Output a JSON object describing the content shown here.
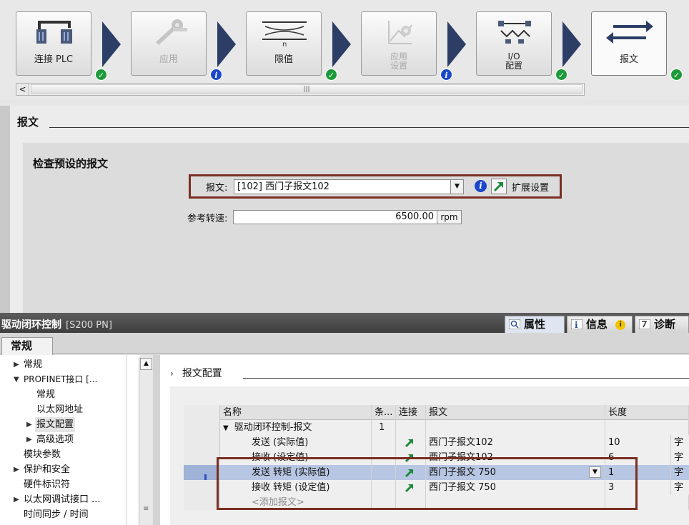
{
  "wizard": {
    "steps": [
      {
        "label": "连接 PLC",
        "icon": "plc-network-icon",
        "status": "ok"
      },
      {
        "label": "应用",
        "icon": "wrench-icon",
        "status": "info"
      },
      {
        "label": "限值",
        "icon": "limit-icon",
        "status": "ok"
      },
      {
        "label_line1": "应用",
        "label_line2": "设置",
        "icon": "app-settings-icon",
        "status": "info"
      },
      {
        "label_line1": "I/O",
        "label_line2": "配置",
        "icon": "io-config-icon",
        "status": "ok"
      },
      {
        "label": "报文",
        "icon": "telegram-arrows-icon",
        "status": "ok"
      }
    ],
    "scroll_left": "<",
    "scroll_grip": "|||"
  },
  "section": {
    "title": "报文",
    "panel_title": "检查预设的报文",
    "telegram_label": "报文:",
    "telegram_value": "[102] 西门子报文102",
    "extended_settings": "扩展设置",
    "ref_speed_label": "参考转速:",
    "ref_speed_value": "6500.00",
    "ref_speed_unit": "rpm"
  },
  "inspector": {
    "title": "驱动闭环控制",
    "subtitle": "[S200 PN]",
    "tabs": {
      "properties": "属性",
      "info": "信息",
      "diagnostics": "诊断"
    },
    "general_tab": "常规"
  },
  "tree": {
    "items": [
      {
        "label": "常规",
        "twisty": "▶"
      },
      {
        "label": "PROFINET接口 [...",
        "twisty": "▼"
      },
      {
        "label": "常规",
        "twisty": ""
      },
      {
        "label": "以太网地址",
        "twisty": ""
      },
      {
        "label": "报文配置",
        "twisty": "▶"
      },
      {
        "label": "高级选项",
        "twisty": "▶"
      },
      {
        "label": "模块参数",
        "twisty": ""
      },
      {
        "label": "保护和安全",
        "twisty": "▶"
      },
      {
        "label": "硬件标识符",
        "twisty": ""
      },
      {
        "label": "以太网调试接口 ...",
        "twisty": "▶"
      },
      {
        "label": "时间同步 / 时间",
        "twisty": ""
      }
    ]
  },
  "content": {
    "title": "报文配置",
    "columns": {
      "name": "名称",
      "count": "条...",
      "connect": "连接",
      "telegram": "报文",
      "length": "长度"
    },
    "group": {
      "label": "驱动闭环控制-报文",
      "count": "1"
    },
    "rows": [
      {
        "name": "发送 (实际值)",
        "telegram": "西门子报文102",
        "length": "10",
        "unit": "字"
      },
      {
        "name": "接收 (设定值)",
        "telegram": "西门子报文102",
        "length": "6",
        "unit": "字"
      },
      {
        "name": "发送 转矩 (实际值)",
        "telegram": "西门子报文 750",
        "length": "1",
        "unit": "字"
      },
      {
        "name": "接收 转矩 (设定值)",
        "telegram": "西门子报文 750",
        "length": "3",
        "unit": "字"
      }
    ],
    "add_row": "<添加报文>"
  }
}
